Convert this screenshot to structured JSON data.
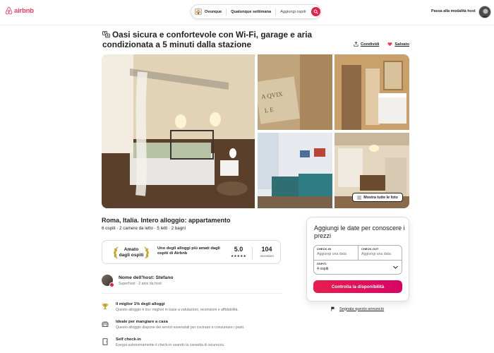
{
  "header": {
    "logo_text": "airbnb",
    "search": {
      "where": "Ovunque",
      "when": "Qualunque settimana",
      "who": "Aggiungi ospiti"
    },
    "host_link": "Passa alla modalità host"
  },
  "listing": {
    "title": "Oasi sicura e confortevole con Wi-Fi, garage e aria condizionata a 5 minuti dalla stazione",
    "share_label": "Condividi",
    "save_label": "Salvato",
    "show_all_photos": "Mostra tutte le foto",
    "subtitle": "Roma, Italia. Intero alloggio: appartamento",
    "details": "6 ospiti · 2 camere da letto · 5 letti · 2 bagni"
  },
  "guest_favorite": {
    "badge": "Amato\ndagli ospiti",
    "description": "Uno degli alloggi più amati dagli ospiti di Airbnb",
    "rating": "5.0",
    "stars": "★★★★★",
    "reviews_count": "104",
    "reviews_label": "recensioni"
  },
  "host": {
    "name": "Nome dell'host: Stefano",
    "subtitle": "Superhost · 2 anni da host"
  },
  "highlights": [
    {
      "icon": "trophy-icon",
      "title": "Il miglior 1% degli alloggi",
      "desc": "Questo alloggio è tra i migliori in base a valutazioni, recensioni e affidabilità."
    },
    {
      "icon": "kitchen-icon",
      "title": "Ideale per mangiare a casa",
      "desc": "Questo alloggio dispone dei servizi essenziali per cucinare e consumare i pasti."
    },
    {
      "icon": "door-icon",
      "title": "Self check-in",
      "desc": "Esegui autonomamente il check-in usando la cassetta di sicurezza."
    }
  ],
  "booking": {
    "title": "Aggiungi le date per conoscere i prezzi",
    "checkin_label": "CHECK-IN",
    "checkin_value": "Aggiungi una data",
    "checkout_label": "CHECK-OUT",
    "checkout_value": "Aggiungi una data",
    "guests_label": "OSPITI",
    "guests_value": "4 ospiti",
    "cta": "Controlla la disponibilità",
    "report": "Segnala questo annuncio"
  },
  "colors": {
    "brand": "#ff385c",
    "cta_start": "#e61e4d",
    "cta_end": "#d70466"
  }
}
